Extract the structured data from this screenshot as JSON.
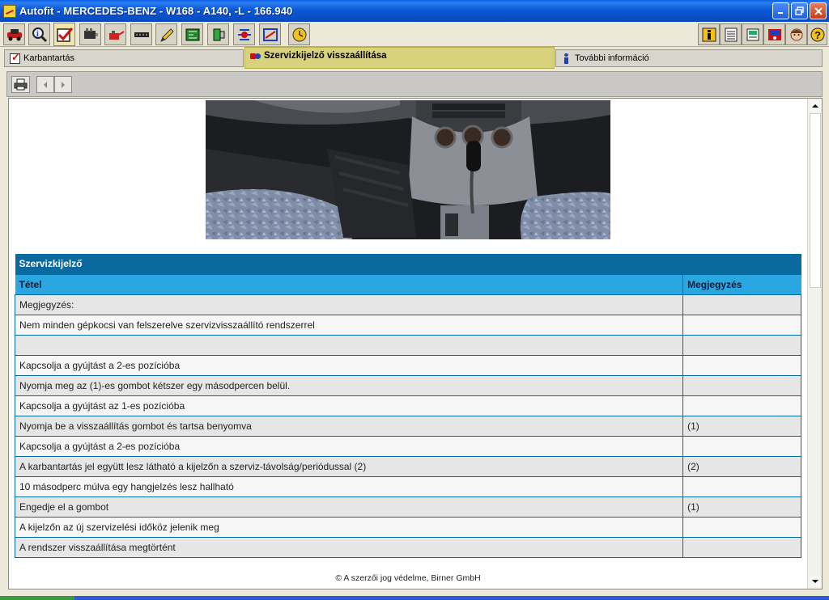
{
  "window": {
    "title": "Autofit - MERCEDES-BENZ - W168 - A140, -L - 166.940"
  },
  "toolbar": {
    "left_icons": [
      "car-icon",
      "search-info-icon",
      "checklist-icon",
      "engine-icon",
      "oil-can-icon",
      "belt-icon",
      "pencil-icon",
      "circuit-icon",
      "connector-icon",
      "adjustment-icon",
      "alignment-icon",
      "clock-icon"
    ],
    "right_icons": [
      "info-icon",
      "list-icon",
      "document-icon",
      "user-icon",
      "assistant-icon",
      "help-icon"
    ]
  },
  "tabs": [
    {
      "label": "Karbantartás",
      "icon": "check-icon"
    },
    {
      "label": "Szervizkijelző visszaállítása",
      "icon": "reset-icon"
    },
    {
      "label": "További információ",
      "icon": "info-icon"
    }
  ],
  "subtoolbar": {
    "print": "printer-icon",
    "back": "arrow-left-icon",
    "forward": "arrow-right-icon"
  },
  "photo": {
    "icon": "car-interior-photo"
  },
  "table": {
    "title": "Szervizkijelző",
    "col1": "Tétel",
    "col2": "Megjegyzés",
    "rows": [
      {
        "item": "Megjegyzés:",
        "note": ""
      },
      {
        "item": "Nem minden gépkocsi van felszerelve szervizvisszaállító rendszerrel",
        "note": ""
      },
      {
        "item": "",
        "note": ""
      },
      {
        "item": "Kapcsolja a gyújtást a 2-es pozícióba",
        "note": ""
      },
      {
        "item": "Nyomja meg az (1)-es gombot kétszer egy másodpercen belül.",
        "note": ""
      },
      {
        "item": "Kapcsolja a gyújtást az 1-es pozícióba",
        "note": ""
      },
      {
        "item": "Nyomja be a visszaállítás gombot és tartsa benyomva",
        "note": "(1)"
      },
      {
        "item": "Kapcsolja a gyújtást a 2-es pozícióba",
        "note": ""
      },
      {
        "item": "A karbantartás jel együtt lesz látható a kijelzőn a szerviz-távolság/periódussal (2)",
        "note": "(2)"
      },
      {
        "item": "10 másodperc múlva egy hangjelzés lesz hallható",
        "note": ""
      },
      {
        "item": "Engedje el a gombot",
        "note": "(1)"
      },
      {
        "item": "A kijelzőn az új szervizelési időköz jelenik meg",
        "note": ""
      },
      {
        "item": "A rendszer visszaállítása megtörtént",
        "note": ""
      }
    ]
  },
  "footer": {
    "copyright": "© A szerzői jog védelme, Birner GmbH"
  },
  "colors": {
    "titlebar": "#0a58d6",
    "table_header": "#0a6aa0",
    "column_header": "#2aa7e0",
    "selected_tab": "#d9d27c"
  }
}
